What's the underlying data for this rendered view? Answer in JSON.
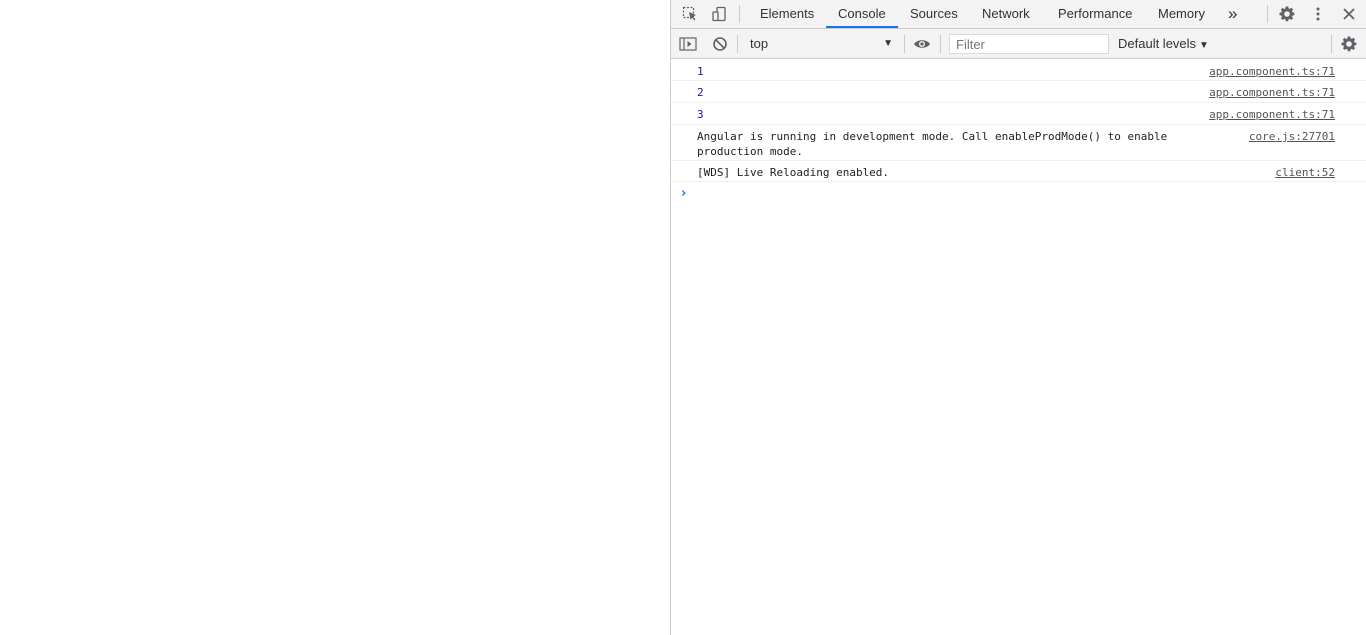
{
  "devtools": {
    "tabs": [
      {
        "label": "Elements",
        "active": false
      },
      {
        "label": "Console",
        "active": true
      },
      {
        "label": "Sources",
        "active": false
      },
      {
        "label": "Network",
        "active": false
      },
      {
        "label": "Performance",
        "active": false
      },
      {
        "label": "Memory",
        "active": false
      }
    ],
    "more_tabs_label": "»",
    "colors": {
      "accent": "#1a73e8",
      "toolbar_bg": "#f3f3f3",
      "border": "#cccccc",
      "number_color": "#1a1aa6",
      "prompt_color": "#1a73e8"
    }
  },
  "console_toolbar": {
    "context_value": "top",
    "filter_placeholder": "Filter",
    "levels_label": "Default levels"
  },
  "messages": [
    {
      "text": "1",
      "source": "app.component.ts:71",
      "type": "number"
    },
    {
      "text": "2",
      "source": "app.component.ts:71",
      "type": "number"
    },
    {
      "text": "3",
      "source": "app.component.ts:71",
      "type": "number"
    },
    {
      "text": "Angular is running in development mode. Call enableProdMode() to enable\nproduction mode.",
      "source": "core.js:27701",
      "type": "log"
    },
    {
      "text": "[WDS] Live Reloading enabled.",
      "source": "client:52",
      "type": "log"
    }
  ],
  "prompt_symbol": "›",
  "icons": [
    "inspect-element-icon",
    "device-toolbar-icon",
    "more-tabs-icon",
    "settings-icon",
    "kebab-menu-icon",
    "close-icon",
    "show-sidebar-icon",
    "clear-console-icon",
    "live-expression-eye-icon",
    "console-settings-icon"
  ]
}
